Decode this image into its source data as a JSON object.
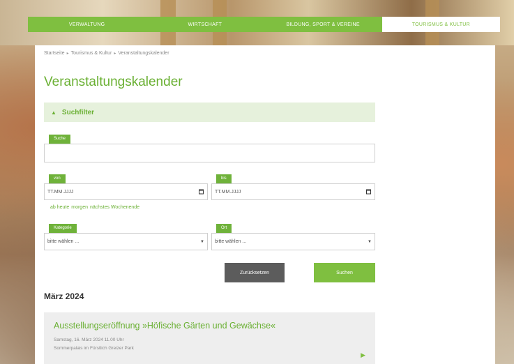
{
  "nav": {
    "items": [
      {
        "label": "VERWALTUNG"
      },
      {
        "label": "WIRTSCHAFT"
      },
      {
        "label": "BILDUNG, SPORT & VEREINE"
      },
      {
        "label": "TOURISMUS & KULTUR"
      }
    ]
  },
  "breadcrumb": {
    "items": [
      "Startseite",
      "Tourismus & Kultur",
      "Veranstaltungskalender"
    ],
    "separator": "▸"
  },
  "page": {
    "title": "Veranstaltungskalender"
  },
  "filter": {
    "toggle_label": "Suchfilter",
    "toggle_icon": "▲",
    "search": {
      "label": "Suche",
      "value": "",
      "placeholder": ""
    },
    "from": {
      "label": "von",
      "value": "TT.MM.JJJJ"
    },
    "to": {
      "label": "bis",
      "value": "TT.MM.JJJJ"
    },
    "quick_links": [
      "ab heute",
      "morgen",
      "nächstes Wochenende"
    ],
    "category": {
      "label": "Kategorie",
      "selected": "bitte wählen ..."
    },
    "place": {
      "label": "Ort",
      "selected": "bitte wählen ..."
    },
    "reset_label": "Zurücksetzen",
    "submit_label": "Suchen"
  },
  "results": {
    "month": "März 2024",
    "events": [
      {
        "title": "Ausstellungseröffnung »Höfische Gärten und Gewächse«",
        "date": "Samstag, 16. März 2024 11.00 Uhr",
        "place": "Sommerpalais im Fürstlich Greizer Park"
      }
    ]
  },
  "colors": {
    "accent": "#7fbf40",
    "title_green": "#6ab033",
    "filter_bg": "#e6f1dc",
    "button_dark": "#5c5c5c"
  }
}
